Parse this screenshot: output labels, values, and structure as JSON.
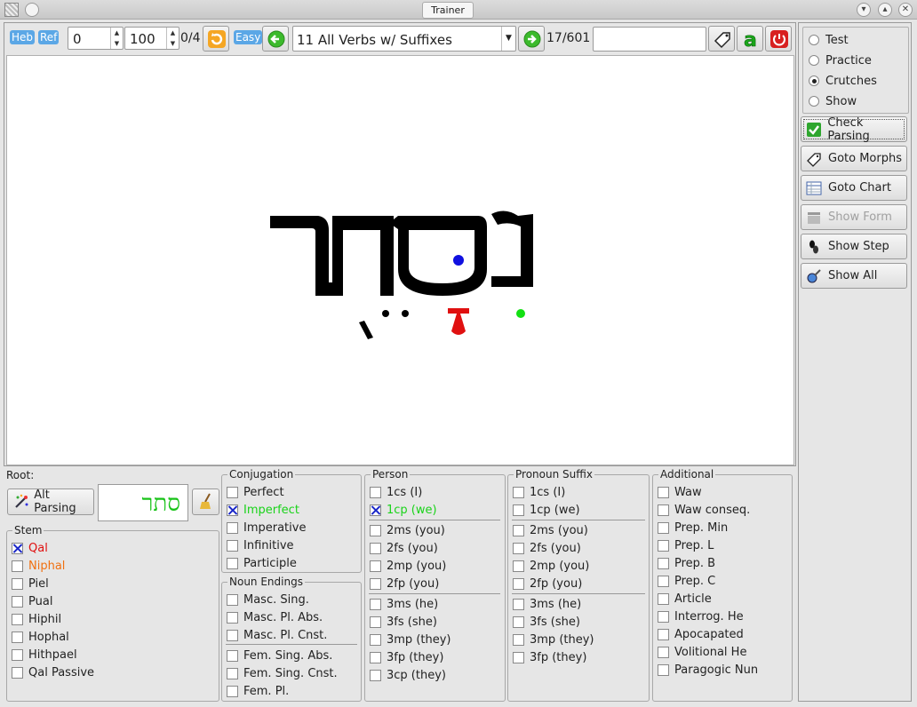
{
  "window": {
    "title": "Trainer"
  },
  "toolbar": {
    "heb_label": "Heb",
    "ref_label": "Ref",
    "start_value": "0",
    "end_value": "100",
    "score": "0/4",
    "easy_label": "Easy",
    "lesson": "11 All Verbs w/ Suffixes",
    "position": "17/601",
    "search_value": ""
  },
  "display": {
    "word": "נִסְתַּר"
  },
  "modes": [
    {
      "label": "Test",
      "selected": false
    },
    {
      "label": "Practice",
      "selected": false
    },
    {
      "label": "Crutches",
      "selected": true
    },
    {
      "label": "Show",
      "selected": false
    }
  ],
  "actions": {
    "check_parsing": "Check Parsing",
    "goto_morphs": "Goto Morphs",
    "goto_chart": "Goto Chart",
    "show_form": "Show Form",
    "show_step": "Show Step",
    "show_all": "Show All"
  },
  "root": {
    "label": "Root:",
    "alt_parsing": "Alt Parsing",
    "value": "סתר"
  },
  "stem": {
    "title": "Stem",
    "items": [
      {
        "label": "Qal",
        "checked": true,
        "color": "#e01010"
      },
      {
        "label": "Niphal",
        "checked": false,
        "color": "#f07010"
      },
      {
        "label": "Piel",
        "checked": false,
        "color": "#222222"
      },
      {
        "label": "Pual",
        "checked": false,
        "color": "#222222"
      },
      {
        "label": "Hiphil",
        "checked": false,
        "color": "#222222"
      },
      {
        "label": "Hophal",
        "checked": false,
        "color": "#222222"
      },
      {
        "label": "Hithpael",
        "checked": false,
        "color": "#222222"
      },
      {
        "label": "Qal Passive",
        "checked": false,
        "color": "#222222"
      }
    ]
  },
  "conjugation": {
    "title": "Conjugation",
    "items": [
      {
        "label": "Perfect",
        "checked": false,
        "color": "#222222"
      },
      {
        "label": "Imperfect",
        "checked": true,
        "color": "#19d319"
      },
      {
        "label": "Imperative",
        "checked": false,
        "color": "#222222"
      },
      {
        "label": "Infinitive",
        "checked": false,
        "color": "#222222"
      },
      {
        "label": "Participle",
        "checked": false,
        "color": "#222222"
      }
    ]
  },
  "noun_endings": {
    "title": "Noun Endings",
    "items": [
      {
        "label": "Masc. Sing.",
        "checked": false
      },
      {
        "label": "Masc. Pl. Abs.",
        "checked": false
      },
      {
        "label": "Masc. Pl. Cnst.",
        "checked": false
      },
      {
        "label": "Fem. Sing. Abs.",
        "checked": false
      },
      {
        "label": "Fem. Sing. Cnst.",
        "checked": false
      },
      {
        "label": "Fem. Pl.",
        "checked": false
      }
    ]
  },
  "person": {
    "title": "Person",
    "items": [
      {
        "label": "1cs (I)",
        "checked": false,
        "color": "#222222"
      },
      {
        "label": "1cp (we)",
        "checked": true,
        "color": "#19d319"
      },
      {
        "label": "2ms (you)",
        "checked": false,
        "color": "#222222"
      },
      {
        "label": "2fs (you)",
        "checked": false,
        "color": "#222222"
      },
      {
        "label": "2mp (you)",
        "checked": false,
        "color": "#222222"
      },
      {
        "label": "2fp (you)",
        "checked": false,
        "color": "#222222"
      },
      {
        "label": "3ms (he)",
        "checked": false,
        "color": "#222222"
      },
      {
        "label": "3fs (she)",
        "checked": false,
        "color": "#222222"
      },
      {
        "label": "3mp (they)",
        "checked": false,
        "color": "#222222"
      },
      {
        "label": "3fp (they)",
        "checked": false,
        "color": "#222222"
      },
      {
        "label": "3cp (they)",
        "checked": false,
        "color": "#222222"
      }
    ]
  },
  "pronoun_suffix": {
    "title": "Pronoun Suffix",
    "items": [
      {
        "label": "1cs (I)",
        "checked": false
      },
      {
        "label": "1cp (we)",
        "checked": false
      },
      {
        "label": "2ms (you)",
        "checked": false
      },
      {
        "label": "2fs (you)",
        "checked": false
      },
      {
        "label": "2mp (you)",
        "checked": false
      },
      {
        "label": "2fp (you)",
        "checked": false
      },
      {
        "label": "3ms (he)",
        "checked": false
      },
      {
        "label": "3fs (she)",
        "checked": false
      },
      {
        "label": "3mp (they)",
        "checked": false
      },
      {
        "label": "3fp (they)",
        "checked": false
      }
    ]
  },
  "additional": {
    "title": "Additional",
    "items": [
      {
        "label": "Waw",
        "checked": false
      },
      {
        "label": "Waw conseq.",
        "checked": false
      },
      {
        "label": "Prep. Min",
        "checked": false
      },
      {
        "label": "Prep. L",
        "checked": false
      },
      {
        "label": "Prep. B",
        "checked": false
      },
      {
        "label": "Prep. C",
        "checked": false
      },
      {
        "label": "Article",
        "checked": false
      },
      {
        "label": "Interrog. He",
        "checked": false
      },
      {
        "label": "Apocapated",
        "checked": false
      },
      {
        "label": "Volitional He",
        "checked": false
      },
      {
        "label": "Paragogic Nun",
        "checked": false
      }
    ]
  }
}
